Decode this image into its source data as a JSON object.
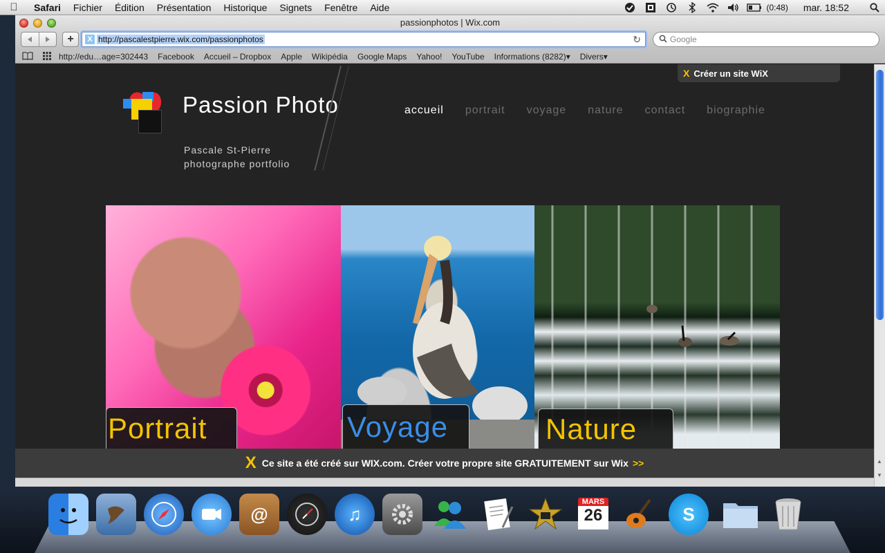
{
  "menubar": {
    "app": "Safari",
    "items": [
      "Fichier",
      "Édition",
      "Présentation",
      "Historique",
      "Signets",
      "Fenêtre",
      "Aide"
    ],
    "battery": "(0:48)",
    "clock": "mar. 18:52"
  },
  "browser": {
    "title": "passionphotos | Wix.com",
    "url": "http://pascalestpierre.wix.com/passionphotos",
    "search_placeholder": "Google",
    "bookmarks": [
      "http://edu…age=302443",
      "Facebook",
      "Accueil – Dropbox",
      "Apple",
      "Wikipédia",
      "Google Maps",
      "Yahoo!",
      "YouTube",
      "Informations (8282)▾",
      "Divers▾"
    ]
  },
  "page": {
    "create_site": "Créer un site WiX",
    "site_title": "Passion Photo",
    "subtitle_line1": "Pascale St-Pierre",
    "subtitle_line2": "photographe portfolio",
    "nav": [
      "accueil",
      "portrait",
      "voyage",
      "nature",
      "contact",
      "biographie"
    ],
    "nav_active": "accueil",
    "tiles": [
      {
        "label": "Portrait",
        "color": "#f2c400"
      },
      {
        "label": "Voyage",
        "color": "#3a8ee8"
      },
      {
        "label": "Nature",
        "color": "#f2c400"
      }
    ],
    "banner_text": "Ce site a été créé sur WIX.com. Créer votre propre site GRATUITEMENT sur Wix",
    "banner_arrows": ">>"
  },
  "dock": {
    "calendar_month": "MARS",
    "calendar_day": "26"
  },
  "colors": {
    "accent_yellow": "#f2c400",
    "accent_blue": "#3a8ee8",
    "page_bg": "#232323"
  }
}
